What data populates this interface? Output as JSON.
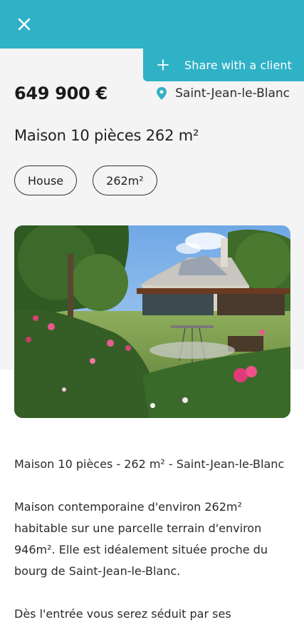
{
  "header": {
    "close_icon": "close-icon",
    "accent_color": "#2fb1c6"
  },
  "share": {
    "label": "Share with a client",
    "icon": "plus-icon"
  },
  "listing": {
    "price": "649 900 €",
    "location": "Saint-Jean-le-Blanc",
    "location_icon": "map-pin-icon",
    "title": "Maison 10 pièces 262 m²",
    "chips": [
      "House",
      "262m²"
    ]
  },
  "gallery": {
    "total_slides": 1,
    "active_slide": 1
  },
  "description": {
    "paragraphs": [
      "Maison 10 pièces - 262 m² - Saint-Jean-le-Blanc",
      "Maison contemporaine d'environ 262m² habitable sur une parcelle terrain d'environ 946m². Elle est idéalement située proche du bourg de Saint-Jean-le-Blanc.",
      "Dès l'entrée vous serez séduit par ses"
    ]
  }
}
